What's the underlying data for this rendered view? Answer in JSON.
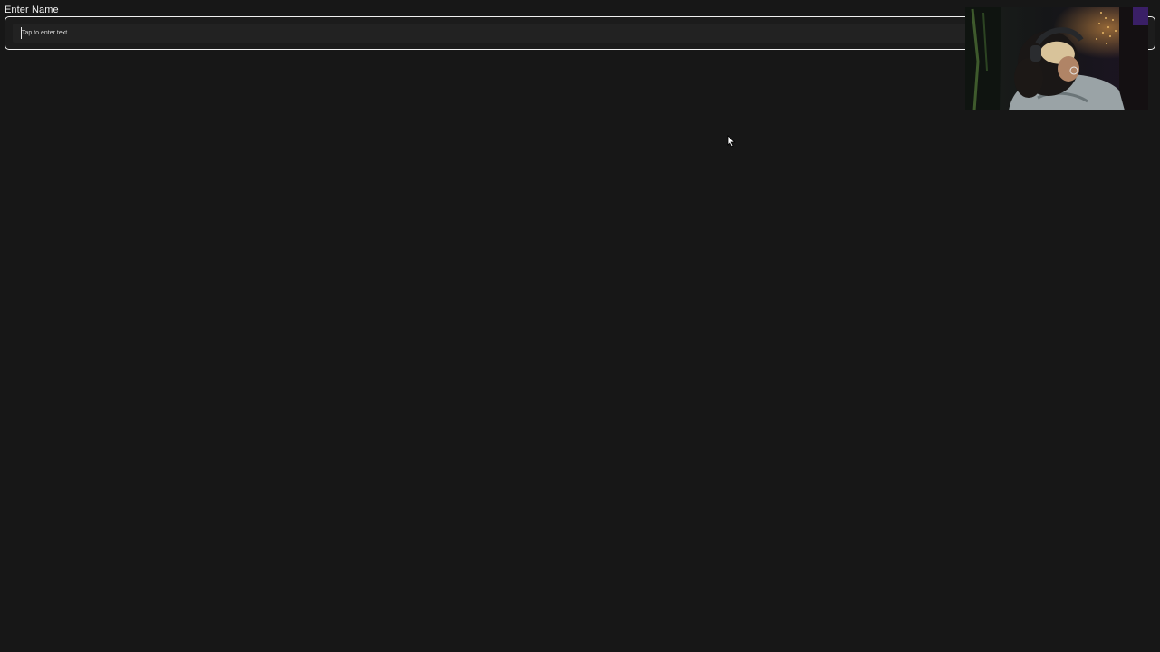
{
  "form": {
    "label": "Enter Name",
    "input": {
      "value": "",
      "placeholder": "Tap to enter text"
    }
  },
  "overlay": {
    "type": "webcam",
    "icon": "person-webcam-feed"
  },
  "colors": {
    "background": "#171717",
    "input_border": "#f0f0f0",
    "text": "#ffffff"
  }
}
